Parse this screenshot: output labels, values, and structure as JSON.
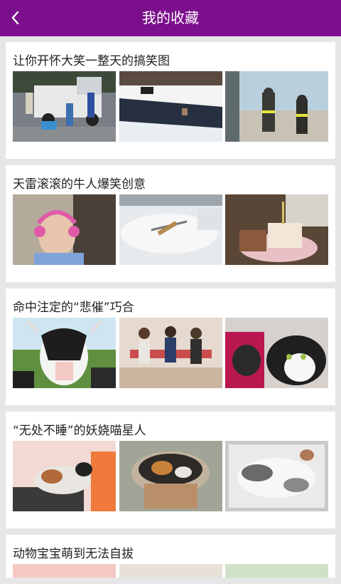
{
  "header": {
    "title": "我的收藏",
    "accent": "#7b0f8c"
  },
  "cards": [
    {
      "title": "让你开怀大笑一整天的搞笑图",
      "thumbs": [
        "truck-people-running-photo",
        "frozen-river-photo",
        "firefighters-photo"
      ]
    },
    {
      "title": "天雷滚滚的牛人爆笑创意",
      "thumbs": [
        "girl-headphones-photo",
        "snow-car-photo",
        "cake-photo"
      ]
    },
    {
      "title": "命中注定的“悲催”巧合",
      "thumbs": [
        "cow-photo",
        "three-men-bench-photo",
        "cat-food-bag-photo"
      ]
    },
    {
      "title": "“无处不睡”的妖娆喵星人",
      "thumbs": [
        "cat-on-ledge-photo",
        "cat-in-pot-photo",
        "cat-sleeping-box-photo"
      ]
    },
    {
      "title": "动物宝宝萌到无法自拔",
      "thumbs": []
    }
  ]
}
